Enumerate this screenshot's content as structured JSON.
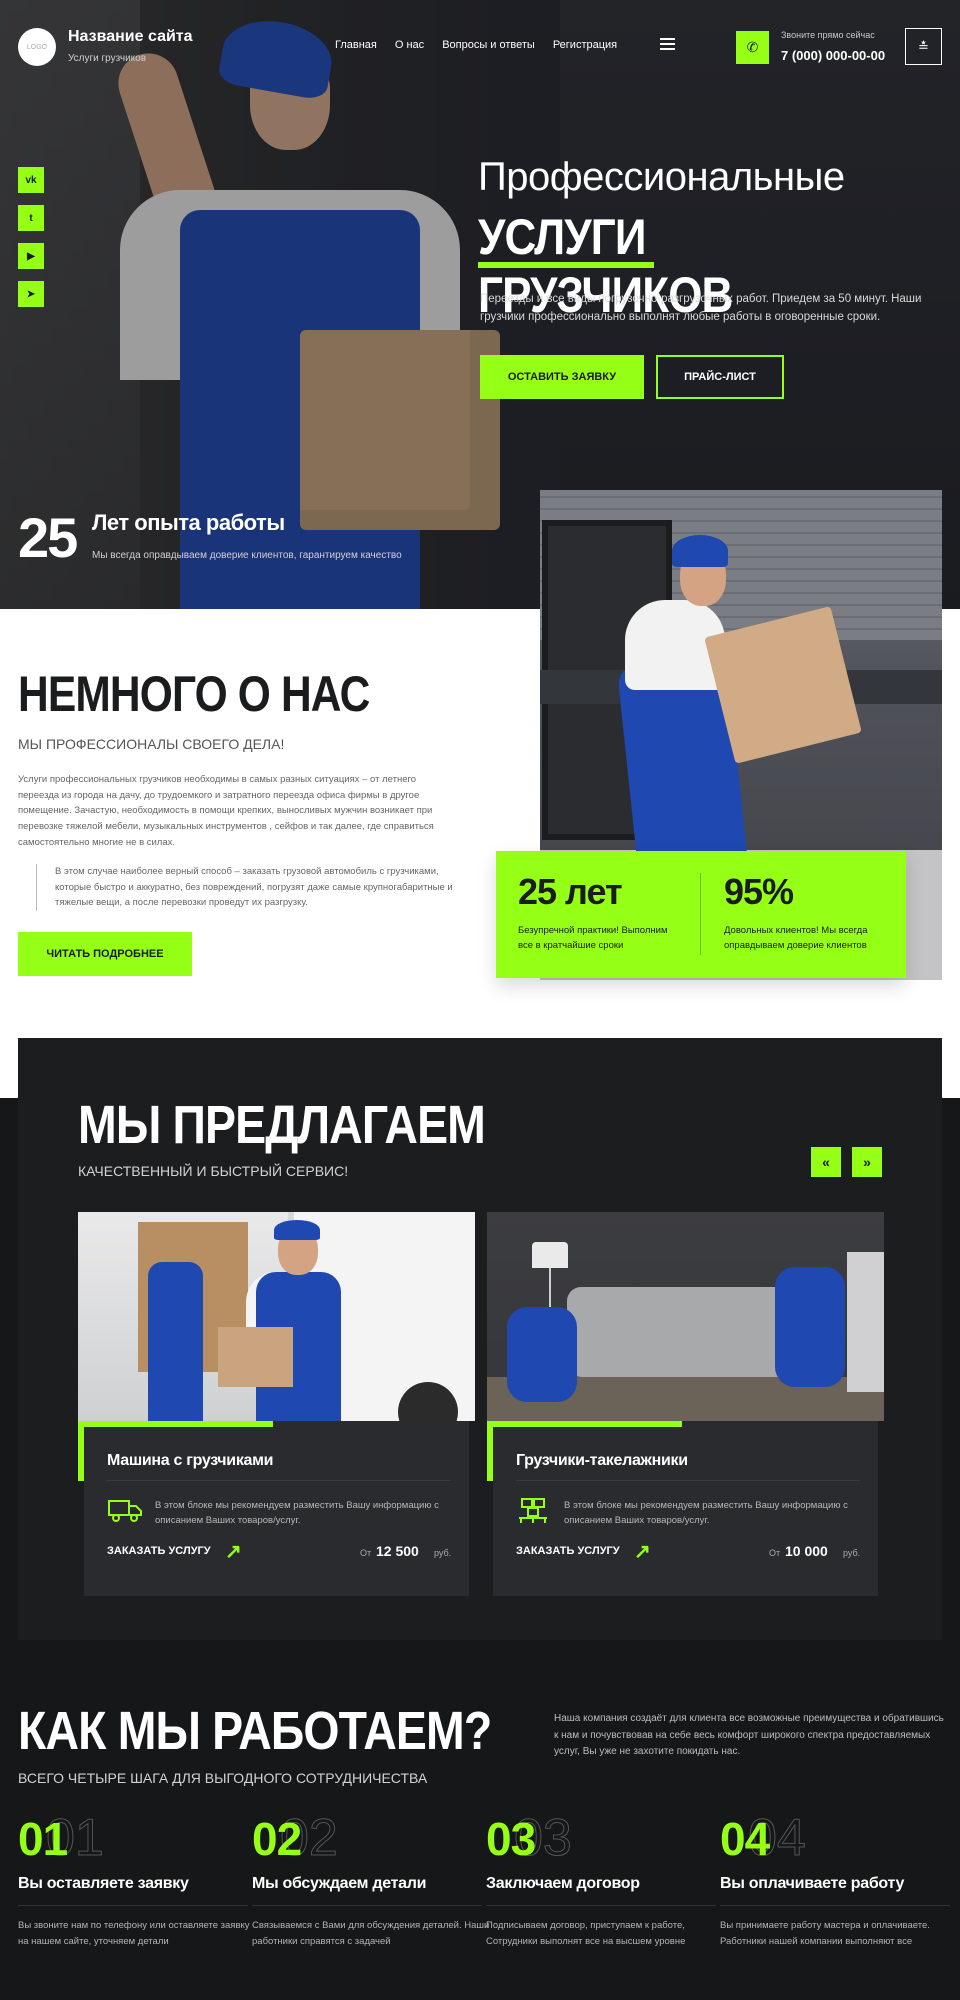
{
  "header": {
    "logo_text": "LOGO",
    "site_name": "Название сайта",
    "site_sub": "Услуги грузчиков",
    "nav": [
      "Главная",
      "О нас",
      "Вопросы и ответы",
      "Регистрация"
    ],
    "phone_hint": "Звоните прямо сейчас",
    "phone": "7 (000) 000-00-00"
  },
  "social": [
    "vk-icon",
    "twitter-icon",
    "youtube-icon",
    "telegram-icon"
  ],
  "hero": {
    "title_line1": "Профессиональные",
    "title_line2": "УСЛУГИ ГРУЗЧИКОВ",
    "description": "Переезды и все виды погрузочно-разгрузочных работ. Приедем за 50 минут. Наши грузчики профессионально выполнят любые работы в оговоренные сроки.",
    "btn_request": "ОСТАВИТЬ ЗАЯВКУ",
    "btn_price": "ПРАЙС-ЛИСТ",
    "exp_number": "25",
    "exp_title": "Лет опыта работы",
    "exp_desc": "Мы всегда оправдываем доверие  клиентов, гарантируем качество"
  },
  "about": {
    "title": "НЕМНОГО О НАС",
    "subtitle": "МЫ ПРОФЕССИОНАЛЫ СВОЕГО ДЕЛА!",
    "text": "Услуги профессиональных грузчиков необходимы в самых разных ситуациях – от летнего переезда из города на дачу, до трудоемкого и затратного переезда офиса фирмы в другое помещение. Зачастую, необходимость в помощи крепких, выносливых мужчин возникает при перевозке тяжелой мебели, музыкальных инструментов , сейфов и так далее, где справиться самостоятельно многие не в силах.",
    "quote": "В этом случае наиболее верный способ – заказать грузовой автомобиль с грузчиками, которые быстро и аккуратно, без повреждений, погрузят даже самые крупногабаритные и тяжелые вещи, а после перевозки проведут их разгрузку.",
    "btn_read": "ЧИТАТЬ ПОДРОБНЕЕ",
    "stats": [
      {
        "value": "25 лет",
        "text": "Безупречной практики! Выполним все в кратчайшие сроки"
      },
      {
        "value": "95%",
        "text": "Довольных клиентов! Мы всегда оправдываем доверие клиентов"
      }
    ]
  },
  "offer": {
    "title": "МЫ ПРЕДЛАГАЕМ",
    "subtitle": "КАЧЕСТВЕННЫЙ И БЫСТРЫЙ СЕРВИС!",
    "prev": "«",
    "next": "»",
    "cards": [
      {
        "title": "Машина с грузчиками",
        "icon": "truck-icon",
        "desc": "В этом блоке мы рекомендуем разместить Вашу информацию с описанием Ваших товаров/услуг.",
        "order": "ЗАКАЗАТЬ УСЛУГУ",
        "from": "От",
        "price": "12 500",
        "currency": "руб."
      },
      {
        "title": "Грузчики-такелажники",
        "icon": "pallet-icon",
        "desc": "В этом блоке мы рекомендуем разместить Вашу информацию с описанием Ваших товаров/услуг.",
        "order": "ЗАКАЗАТЬ УСЛУГУ",
        "from": "От",
        "price": "10 000",
        "currency": "руб."
      }
    ]
  },
  "how": {
    "title": "КАК МЫ РАБОТАЕМ?",
    "subtitle": "ВСЕГО ЧЕТЫРЕ ШАГА ДЛЯ ВЫГОДНОГО СОТРУДНИЧЕСТВА",
    "description": "Наша компания создаёт для клиента все возможные преимущества и обратившись к нам и почувствовав на себе весь комфорт широкого спектра предоставляемых услуг, Вы уже не захотите покидать нас.",
    "steps": [
      {
        "num": "01",
        "title": "Вы оставляете заявку",
        "desc": "Вы звоните нам по телефону или оставляете заявку на нашем сайте, уточняем детали"
      },
      {
        "num": "02",
        "title": "Мы обсуждаем детали",
        "desc": "Связываемся с Вами для обсуждения деталей. Наши работники справятся с задачей"
      },
      {
        "num": "03",
        "title": "Заключаем договор",
        "desc": "Подписываем договор, приступаем к работе, Сотрудники выполнят все на высшем уровне"
      },
      {
        "num": "04",
        "title": "Вы оплачиваете работу",
        "desc": "Вы принимаете работу мастера и оплачиваете. Работники нашей компании выполняют все"
      }
    ]
  },
  "colors": {
    "accent": "#96ff16",
    "dark": "#161718",
    "text": "#1b1c1e"
  }
}
